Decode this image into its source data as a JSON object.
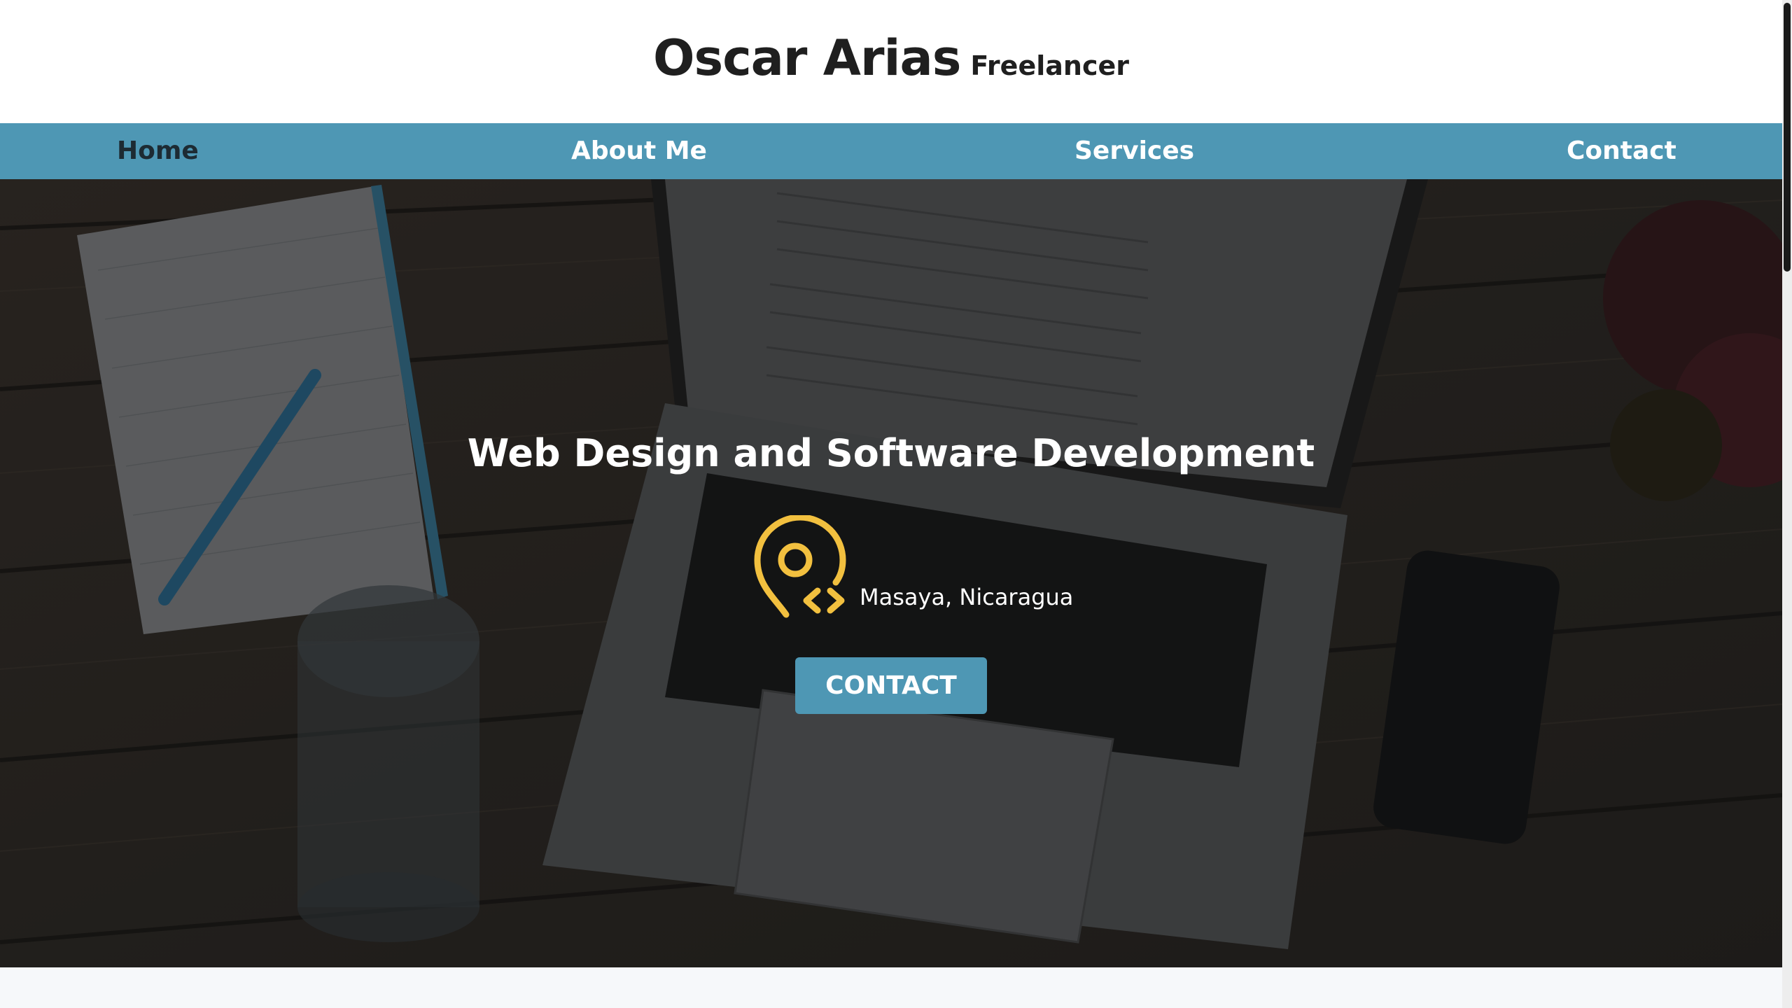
{
  "header": {
    "name": "Oscar Arias",
    "role": "Freelancer"
  },
  "nav": {
    "items": [
      {
        "label": "Home",
        "active": true
      },
      {
        "label": "About Me",
        "active": false
      },
      {
        "label": "Services",
        "active": false
      },
      {
        "label": "Contact",
        "active": false
      }
    ]
  },
  "hero": {
    "title": "Web Design and Software Development",
    "location": "Masaya, Nicaragua",
    "location_icon": "location-code-pin-icon",
    "cta_label": "CONTACT"
  },
  "colors": {
    "nav_bg": "#4e97b4",
    "accent_icon": "#f2c03f",
    "header_bg": "#ffffff",
    "text_dark": "#1f1f1f"
  }
}
